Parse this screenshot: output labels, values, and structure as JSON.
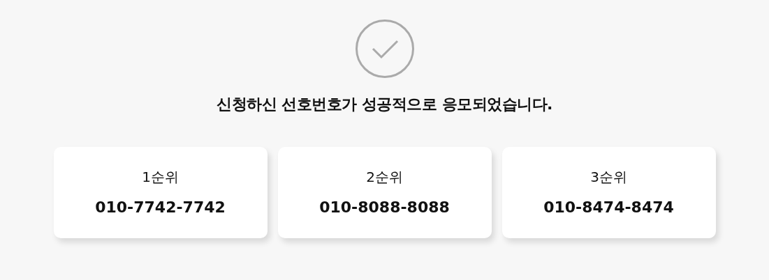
{
  "message": "신청하신 선호번호가 성공적으로 응모되었습니다.",
  "choices": [
    {
      "rank": "1순위",
      "number": "010-7742-7742"
    },
    {
      "rank": "2순위",
      "number": "010-8088-8088"
    },
    {
      "rank": "3순위",
      "number": "010-8474-8474"
    }
  ]
}
